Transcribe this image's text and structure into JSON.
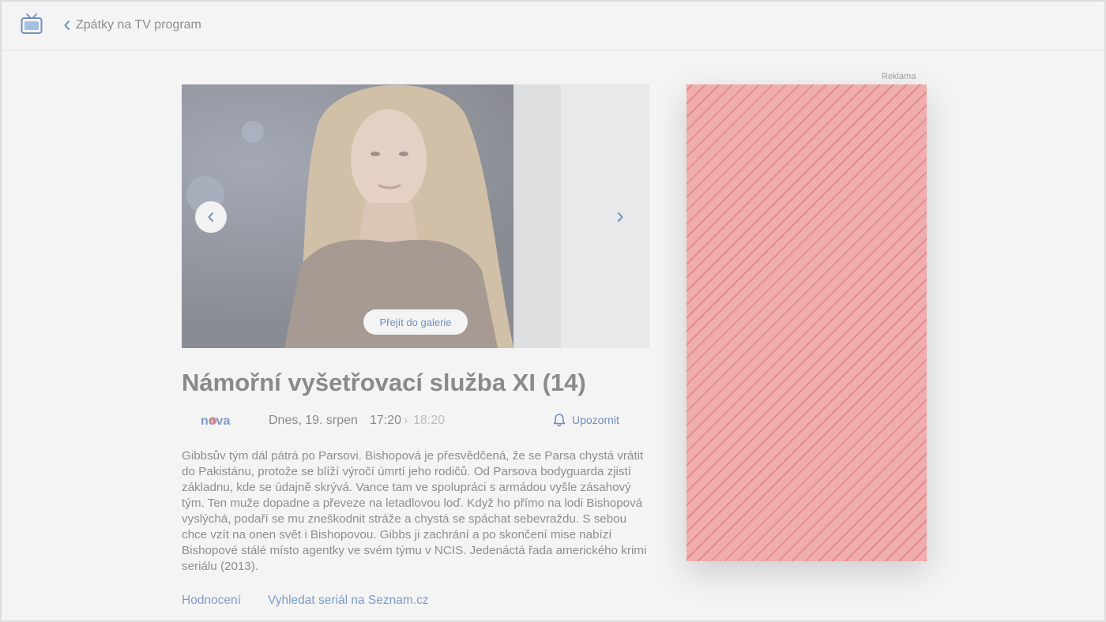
{
  "header": {
    "back_label": "Zpátky na TV program"
  },
  "gallery": {
    "button_label": "Přejít do galerie"
  },
  "program": {
    "title": "Námořní vyšetřovací služba XI (14)",
    "channel": "nova",
    "date": "Dnes, 19. srpen",
    "time_start": "17:20",
    "time_separator": "›",
    "time_end": "18:20",
    "notify_label": "Upozornit",
    "description": "Gibbsův tým dál pátrá po Parsovi. Bishopová je přesvědčená, že se Parsa chystá vrátit do Pakistánu, protože se blíží výročí úmrtí jeho rodičů. Od Parsova bodyguarda zjistí základnu, kde se údajně skrývá. Vance tam ve spolupráci s armádou vyšle zásahový tým. Ten muže dopadne a převeze na letadlovou loď. Když ho přímo na lodi Bishopová vyslýchá, podaří se mu zneškodnit stráže a chystá se spáchat sebevraždu. S sebou chce vzít na onen svět i Bishopovou. Gibbs ji zachrání a po skončení mise nabízí Bishopové stálé místo agentky ve svém týmu v NCIS. Jedenáctá řada amerického krimi seriálu (2013)."
  },
  "links": {
    "rating": "Hodnocení",
    "search_series": "Vyhledat seriál na Seznam.cz"
  },
  "ad": {
    "label": "Reklama"
  },
  "colors": {
    "accent": "#7d9cc9",
    "background": "#f4f4f4",
    "ad_fill": "#efadad"
  },
  "icons": [
    "tv-icon",
    "chevron-left-icon",
    "chevron-right-icon",
    "bell-icon"
  ]
}
